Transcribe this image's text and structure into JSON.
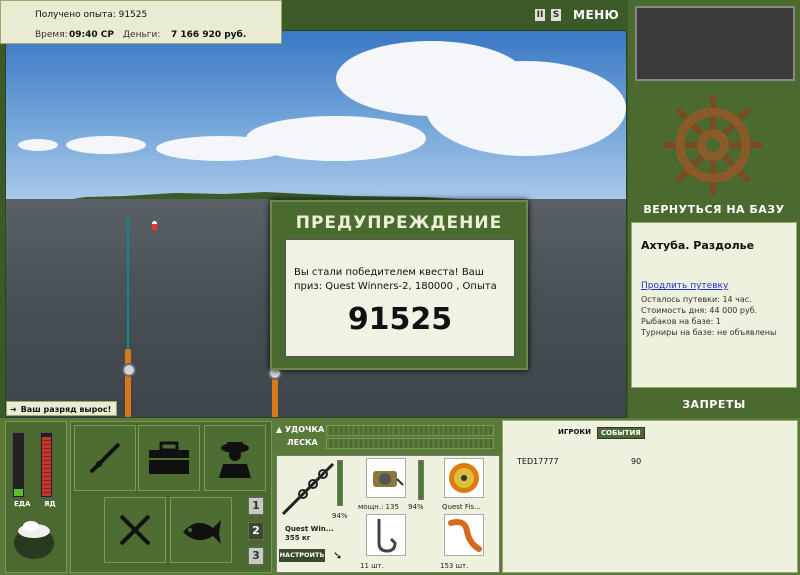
{
  "info": {
    "exp_gained": "Получено опыта: 91525",
    "time_label": "Время:",
    "time_value": "09:40 СР",
    "money_label": "Деньги:",
    "money_value": "7 166 920 руб."
  },
  "toolbar": {
    "pause_label": "II",
    "sound_label": "S",
    "menu_label": "МЕНЮ"
  },
  "right_panel": {
    "return_label": "ВЕРНУТЬСЯ НА БАЗУ",
    "location_name": "Ахтуба. Раздолье",
    "extend_link": "Продлить путевку",
    "lines": [
      "Осталось путевки: 14 час.",
      "Стоимость дня: 44 000 руб.",
      "Рыбаков на базе: 1",
      "Турниры на базе: не объявлены"
    ],
    "bans_label": "ЗАПРЕТЫ"
  },
  "dialog": {
    "title": "ПРЕДУПРЕЖДЕНИЕ",
    "message": "Вы стали победителем квеста! Ваш приз: Quest Winners-2, 180000 , Опыта",
    "value": "91525"
  },
  "rank_notice": "Ваш разряд вырос!",
  "meters": {
    "food_label": "ЕДА",
    "poison_label": "ЯД",
    "food_level": 0.12,
    "poison_level": 0.95
  },
  "slots": [
    "1",
    "2",
    "3"
  ],
  "selected_slot": "2",
  "bars": {
    "rod_label": "УДОЧКА",
    "line_label": "ЛЕСКА"
  },
  "tackle": {
    "rod_name": "Quest Win...",
    "rod_weight": "355 кг",
    "rod_percent": "94%",
    "reel_text": "мощн.: 135",
    "reel_percent": "94%",
    "line_name": "Quest Fis...",
    "hook_count": "11 шт.",
    "bait_count": "153 шт.",
    "setup_label": "НАСТРОИТЬ"
  },
  "events": {
    "tab_players": "ИГРОКИ",
    "tab_events": "СОБЫТИЯ",
    "rows": [
      {
        "name": "TED17777",
        "value": "90"
      }
    ]
  },
  "colors": {
    "panel_green": "#4a6a30",
    "bar_green": "#5a7a3a",
    "panel_light": "#eef1dd",
    "food_red": "#c0392b",
    "health_green": "#5cc02a"
  }
}
